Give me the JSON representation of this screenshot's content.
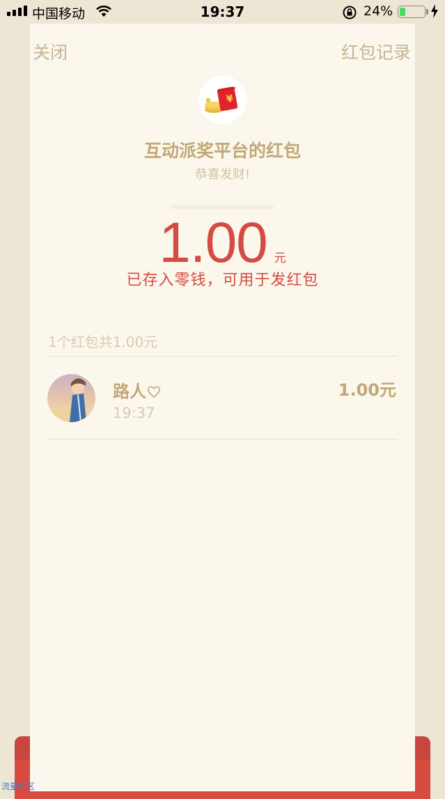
{
  "status_bar": {
    "carrier": "中国移动",
    "time": "19:37",
    "battery_percent": "24%",
    "battery_level": 0.24
  },
  "header": {
    "close_label": "关闭",
    "record_label": "红包记录"
  },
  "packet": {
    "title": "互动派奖平台的红包",
    "greeting": "恭喜发财!",
    "amount": "1.00",
    "unit": "元",
    "notice": "已存入零钱，可用于发红包"
  },
  "summary": "1个红包共1.00元",
  "receivers": [
    {
      "name": "路人",
      "time": "19:37",
      "amount": "1.00元"
    }
  ],
  "watermark": "流量社区",
  "colors": {
    "accent_red": "#d54b42",
    "gold_text": "#c2a877",
    "card_bg": "#fbf7ec"
  }
}
